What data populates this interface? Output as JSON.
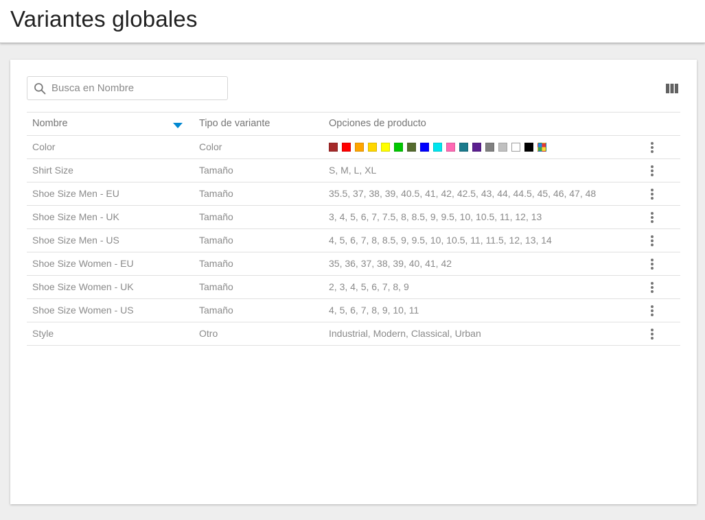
{
  "header": {
    "title": "Variantes globales"
  },
  "search": {
    "placeholder": "Busca en Nombre",
    "value": ""
  },
  "toolbar": {
    "columns_icon": "view-columns-icon"
  },
  "table": {
    "columns": {
      "name": "Nombre",
      "type": "Tipo de variante",
      "options": "Opciones de producto"
    },
    "sort": {
      "column": "Nombre",
      "direction": "descending"
    },
    "rows": [
      {
        "name": "Color",
        "type": "Color",
        "options": ""
      },
      {
        "name": "Shirt Size",
        "type": "Tamaño",
        "options": "S, M, L, XL"
      },
      {
        "name": "Shoe Size Men - EU",
        "type": "Tamaño",
        "options": "35.5, 37, 38, 39, 40.5, 41, 42, 42.5, 43, 44, 44.5, 45, 46, 47, 48"
      },
      {
        "name": "Shoe Size Men - UK",
        "type": "Tamaño",
        "options": "3, 4, 5, 6, 7, 7.5, 8, 8.5, 9, 9.5, 10, 10.5, 11, 12, 13"
      },
      {
        "name": "Shoe Size Men - US",
        "type": "Tamaño",
        "options": "4, 5, 6, 7, 8, 8.5, 9, 9.5, 10, 10.5, 11, 11.5, 12, 13, 14"
      },
      {
        "name": "Shoe Size Women - EU",
        "type": "Tamaño",
        "options": "35, 36, 37, 38, 39, 40, 41, 42"
      },
      {
        "name": "Shoe Size Women - UK",
        "type": "Tamaño",
        "options": "2, 3, 4, 5, 6, 7, 8, 9"
      },
      {
        "name": "Shoe Size Women - US",
        "type": "Tamaño",
        "options": "4, 5, 6, 7, 8, 9, 10, 11"
      },
      {
        "name": "Style",
        "type": "Otro",
        "options": "Industrial, Modern, Classical, Urban"
      }
    ],
    "color_swatches": [
      "#a52a2a",
      "#ff0000",
      "#ffa500",
      "#ffd700",
      "#ffff00",
      "#00c800",
      "#556b2f",
      "#0000ff",
      "#00e5ee",
      "#ff69b4",
      "#1a7a8c",
      "#5b1f8f",
      "#808080",
      "#c0c0c0",
      "#ffffff",
      "#000000",
      "multicolor"
    ]
  },
  "colors": {
    "accent": "#0288d1",
    "text_muted": "#8a8a8a",
    "divider": "#e0e0e0"
  }
}
